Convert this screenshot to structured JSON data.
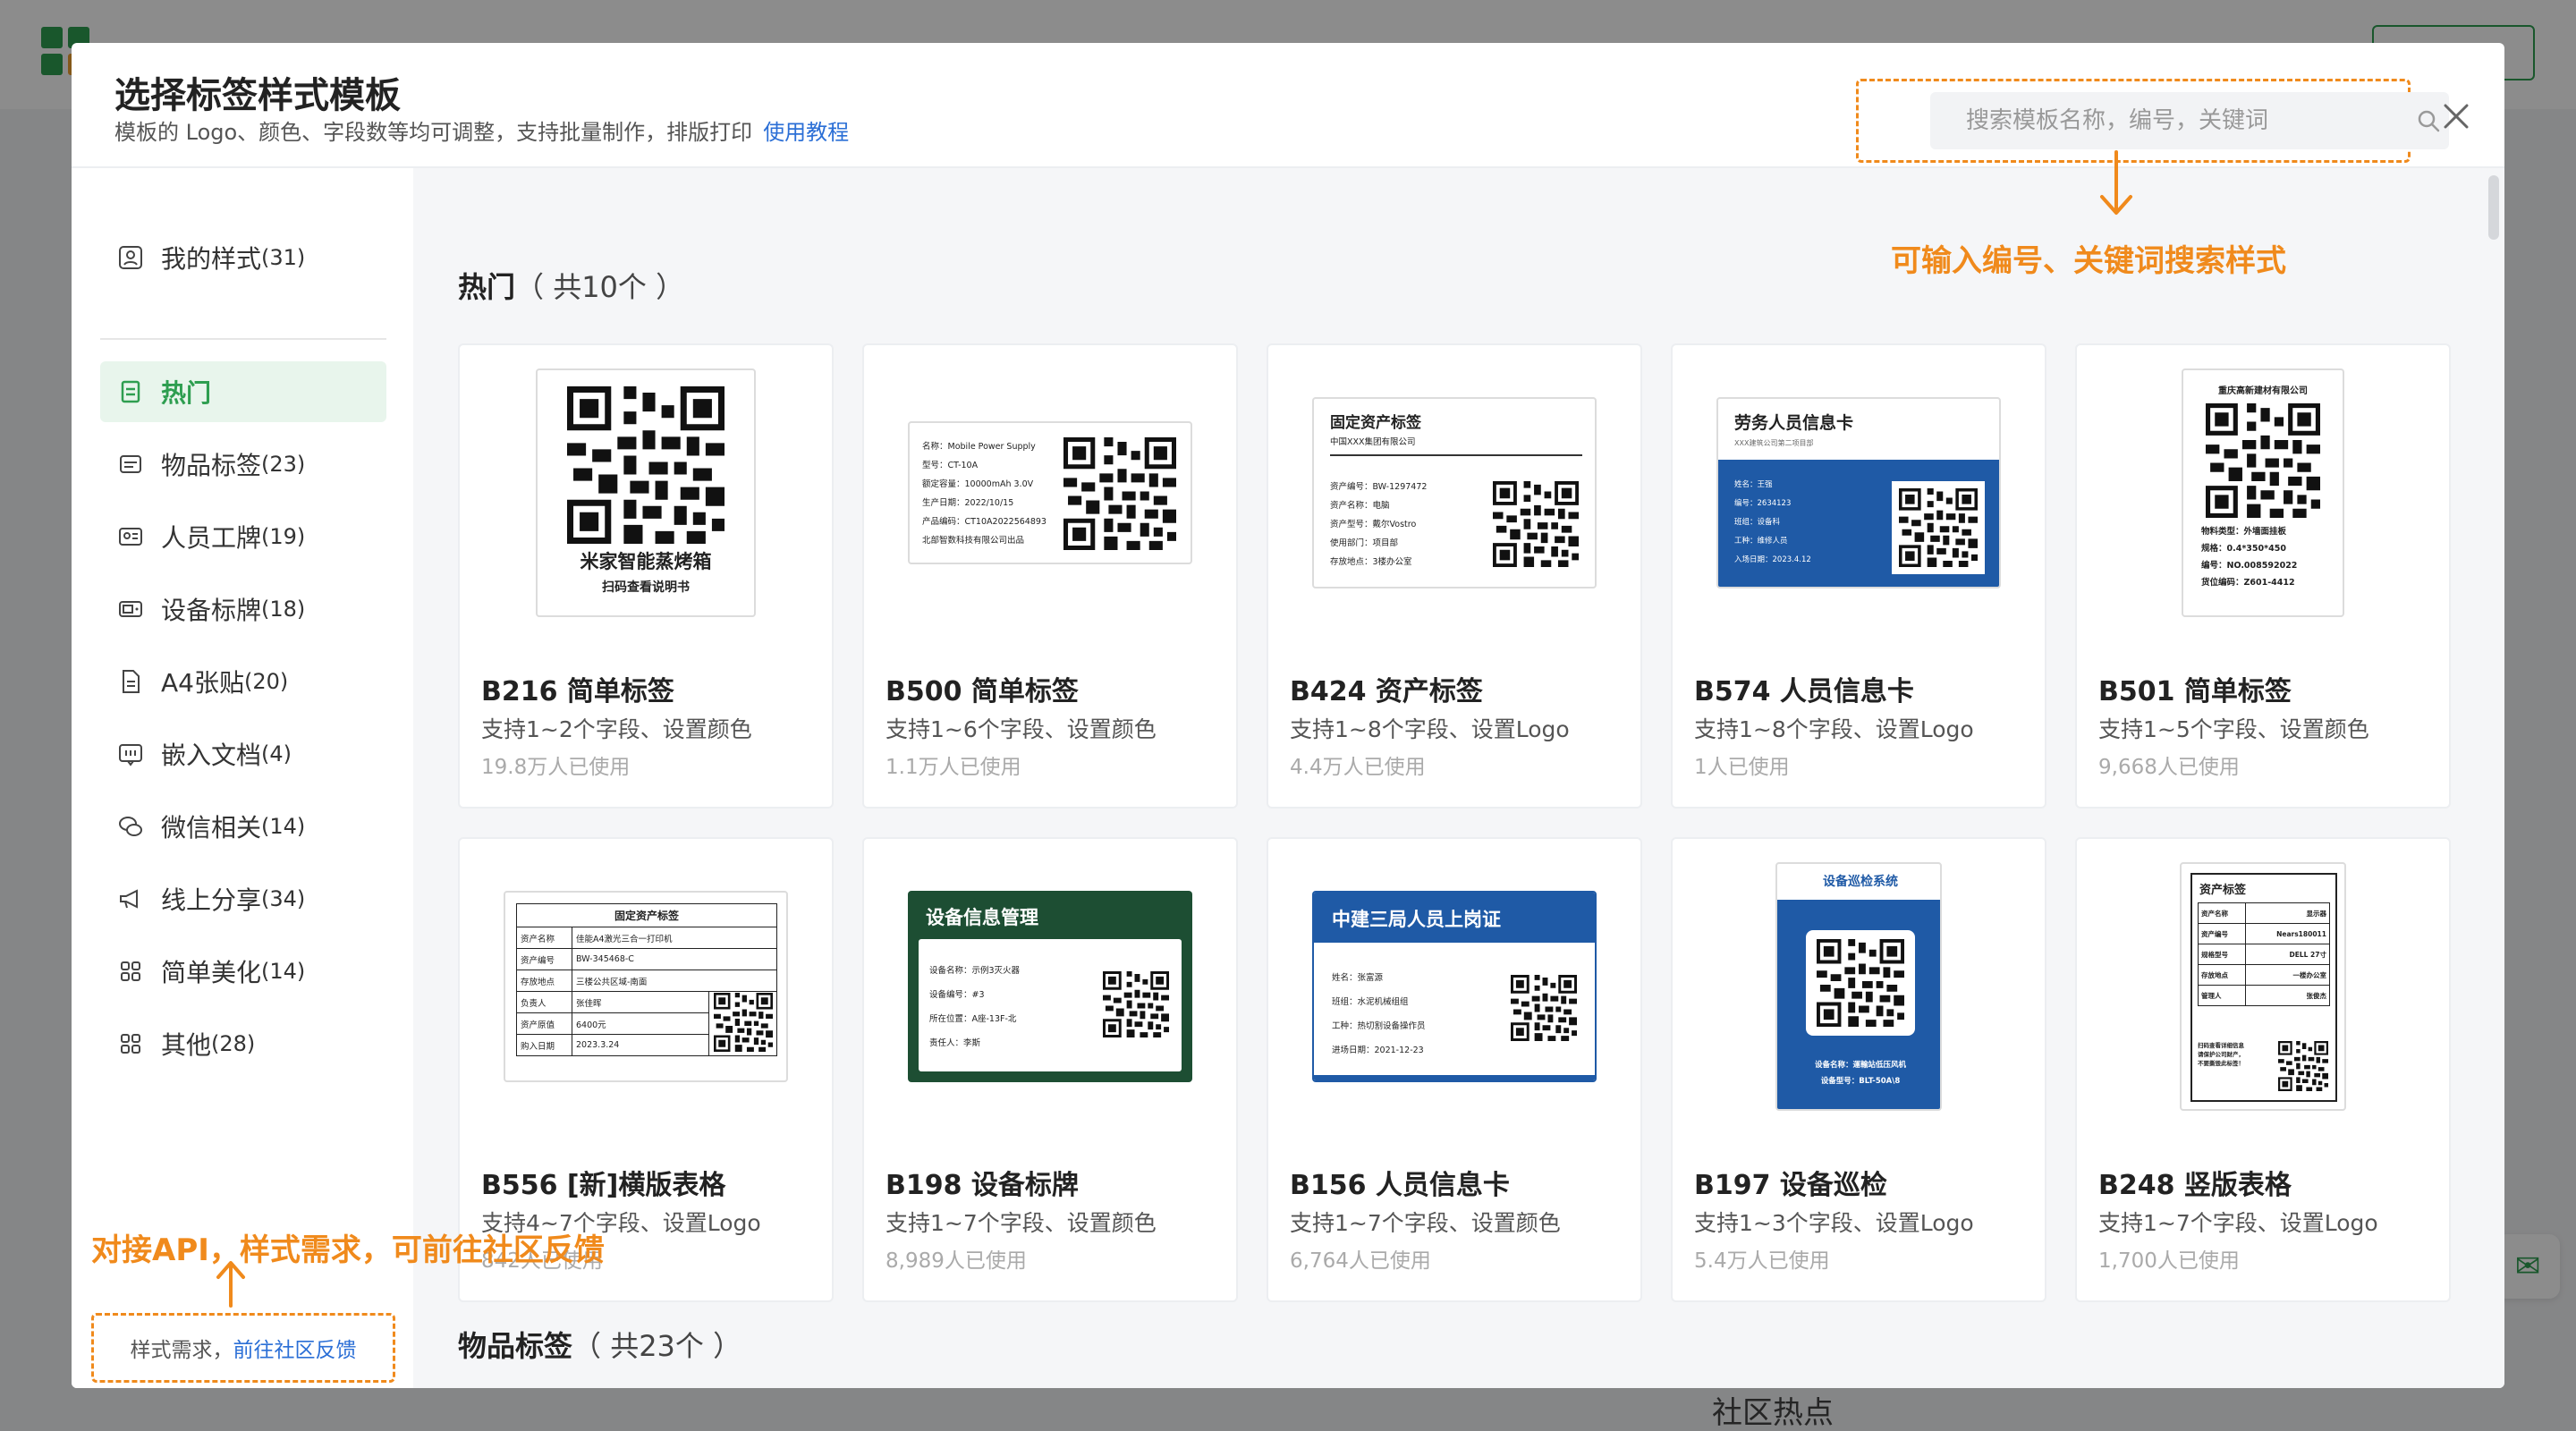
{
  "background": {
    "community_label": "社区热点"
  },
  "modal": {
    "title": "选择标签样式模板",
    "subtitle": "模板的 Logo、颜色、字段数等均可调整，支持批量制作，排版打印",
    "tutorial_link": "使用教程",
    "search_placeholder": "搜索模板名称，编号，关键词"
  },
  "sidebar": {
    "items": [
      {
        "label": "我的样式",
        "count": "(31)",
        "icon": "user-card-icon"
      },
      {
        "label": "热门",
        "count": "",
        "icon": "bookmark-icon",
        "active": true
      },
      {
        "label": "物品标签",
        "count": "(23)",
        "icon": "tag-icon"
      },
      {
        "label": "人员工牌",
        "count": "(19)",
        "icon": "id-card-icon"
      },
      {
        "label": "设备标牌",
        "count": "(18)",
        "icon": "device-icon"
      },
      {
        "label": "A4张贴",
        "count": "(20)",
        "icon": "document-icon"
      },
      {
        "label": "嵌入文档",
        "count": "(4)",
        "icon": "embed-icon"
      },
      {
        "label": "微信相关",
        "count": "(14)",
        "icon": "wechat-icon"
      },
      {
        "label": "线上分享",
        "count": "(34)",
        "icon": "megaphone-icon"
      },
      {
        "label": "简单美化",
        "count": "(14)",
        "icon": "grid-icon"
      },
      {
        "label": "其他",
        "count": "(28)",
        "icon": "grid-icon"
      }
    ],
    "feedback_text": "样式需求，",
    "feedback_link": "前往社区反馈"
  },
  "sections": [
    {
      "title": "热门",
      "count": "（ 共10个 ）"
    },
    {
      "title": "物品标签",
      "count": "（ 共23个 ）"
    }
  ],
  "cards": [
    {
      "name": "B216 简单标签",
      "desc": "支持1~2个字段、设置颜色",
      "usage": "19.8万人已使用",
      "preview": {
        "line1": "米家智能蒸烤箱",
        "line2": "扫码查看说明书"
      }
    },
    {
      "name": "B500 简单标签",
      "desc": "支持1~6个字段、设置颜色",
      "usage": "1.1万人已使用",
      "preview": {
        "rows": [
          "名称：Mobile Power Supply",
          "型号：CT-10A",
          "额定容量：10000mAh 3.0V",
          "生产日期：2022/10/15",
          "产品编码：CT10A2022564893",
          "北部智数科技有限公司出品"
        ]
      }
    },
    {
      "name": "B424 资产标签",
      "desc": "支持1~8个字段、设置Logo",
      "usage": "4.4万人已使用",
      "preview": {
        "title": "固定资产标签",
        "company": "中国XXX集团有限公司",
        "rows": [
          "资产编号：BW-1297472",
          "资产名称：电脑",
          "资产型号：戴尔Vostro",
          "使用部门：项目部",
          "存放地点：3楼办公室"
        ]
      }
    },
    {
      "name": "B574 人员信息卡",
      "desc": "支持1~8个字段、设置Logo",
      "usage": "1人已使用",
      "preview": {
        "title": "劳务人员信息卡",
        "company": "XXX建筑公司第二项目部",
        "rows": [
          "姓名：王强",
          "编号：2634123",
          "班组：设备科",
          "工种：维修人员",
          "入场日期：2023.4.12"
        ]
      }
    },
    {
      "name": "B501 简单标签",
      "desc": "支持1~5个字段、设置颜色",
      "usage": "9,668人已使用",
      "preview": {
        "title": "重庆高新建材有限公司",
        "rows": [
          "物料类型：外墙面挂板",
          "规格：0.4*350*450",
          "编号：NO.008592022",
          "货位编码：Z601-4412"
        ]
      }
    },
    {
      "name": "B556 [新]横版表格",
      "desc": "支持4~7个字段、设置Logo",
      "usage": "842人已使用",
      "preview": {
        "title": "固定资产标签",
        "rows": [
          [
            "资产名称",
            "佳能A4激光三合一打印机"
          ],
          [
            "资产编号",
            "BW-345468-C"
          ],
          [
            "存放地点",
            "三楼公共区域-南面"
          ],
          [
            "负责人",
            "张佳晖"
          ],
          [
            "资产原值",
            "6400元"
          ],
          [
            "购入日期",
            "2023.3.24"
          ]
        ]
      }
    },
    {
      "name": "B198 设备标牌",
      "desc": "支持1~7个字段、设置颜色",
      "usage": "8,989人已使用",
      "preview": {
        "title": "设备信息管理",
        "rows": [
          "设备名称：示例3灭火器",
          "设备编号：#3",
          "所在位置：A座-13F-北",
          "责任人：李斯"
        ]
      }
    },
    {
      "name": "B156 人员信息卡",
      "desc": "支持1~7个字段、设置颜色",
      "usage": "6,764人已使用",
      "preview": {
        "title": "中建三局人员上岗证",
        "rows": [
          "姓名：张富源",
          "班组：水泥机械组组",
          "工种：热切割设备操作员",
          "进场日期：2021-12-23"
        ]
      }
    },
    {
      "name": "B197 设备巡检",
      "desc": "支持1~3个字段、设置Logo",
      "usage": "5.4万人已使用",
      "preview": {
        "title": "设备巡检系统",
        "rows": [
          "设备名称：運輸站低压风机",
          "设备型号：BLT-50A\\8"
        ]
      }
    },
    {
      "name": "B248 竖版表格",
      "desc": "支持1~7个字段、设置Logo",
      "usage": "1,700人已使用",
      "preview": {
        "title": "资产标签",
        "rows": [
          [
            "资产名称",
            "显示器"
          ],
          [
            "资产编号",
            "Nears180011"
          ],
          [
            "规格型号",
            "DELL 27寸"
          ],
          [
            "存放地点",
            "一楼办公室"
          ],
          [
            "管理人",
            "张俊杰"
          ]
        ],
        "footer": "扫码查看详细信息\n请保护公司财产，\n不要撕毁此标签！"
      }
    }
  ],
  "annotations": {
    "search_hint": "可输入编号、关键词搜索样式",
    "feedback_hint": "对接API，样式需求，可前往社区反馈"
  },
  "colors": {
    "brand_green": "#2e9e50",
    "annotation_orange": "#f08a1c",
    "link_blue": "#2b6fd6",
    "badge_blue": "#1f5aa6",
    "dark_green": "#1d4e33"
  }
}
